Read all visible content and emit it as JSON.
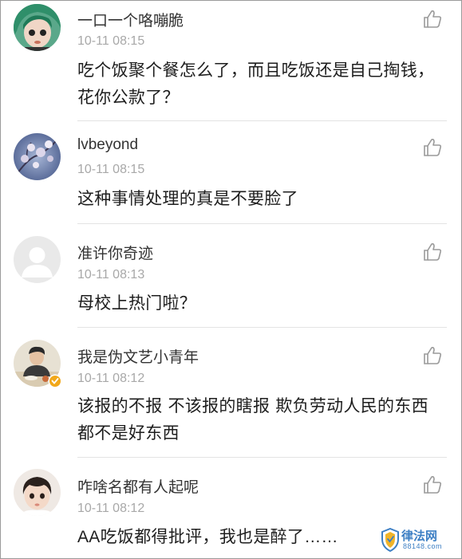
{
  "comments": [
    {
      "username": "一口一个咯嘣脆",
      "time": "10-11 08:15",
      "text": "吃个饭聚个餐怎么了，而且吃饭还是自己掏钱，花你公款了？",
      "avatar_icon": "avatar-green-hair-girl"
    },
    {
      "username": "lvbeyond",
      "time": "10-11 08:15",
      "text": "这种事情处理的真是不要脸了",
      "avatar_icon": "avatar-cherry-blossom"
    },
    {
      "username": "准许你奇迹",
      "time": "10-11 08:13",
      "text": "母校上热门啦？",
      "avatar_icon": "avatar-default"
    },
    {
      "username": "我是伪文艺小青年",
      "time": "10-11 08:12",
      "text": "该报的不报 不该报的瞎报 欺负劳动人民的东西都不是好东西",
      "avatar_icon": "avatar-man-verified"
    },
    {
      "username": "咋啥名都有人起呢",
      "time": "10-11 08:12",
      "text": "AA吃饭都得批评，我也是醉了……",
      "avatar_icon": "avatar-child"
    }
  ],
  "watermark": {
    "name": "律法网",
    "domain": "88148.com"
  }
}
